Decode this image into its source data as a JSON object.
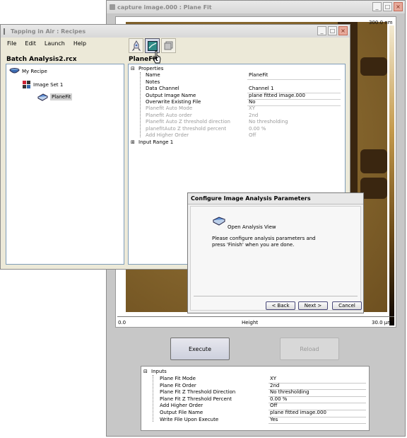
{
  "plane_window": {
    "title": "capture image.000 : Plane Fit",
    "colorbar_max": "300.0 nm",
    "x_axis_start": "0.0",
    "x_axis_label": "Height",
    "x_axis_end": "30.0 µm",
    "execute_label": "Execute",
    "reload_label": "Reload",
    "inputs_header": "Inputs",
    "inputs": [
      {
        "name": "Plane Fit Mode",
        "value": "XY"
      },
      {
        "name": "Plane Fit Order",
        "value": "2nd"
      },
      {
        "name": "Plane Fit Z Threshold Direction",
        "value": "No thresholding"
      },
      {
        "name": "Plane Fit Z Threshold Percent",
        "value": "0.00 %"
      },
      {
        "name": "Add Higher Order",
        "value": "Off"
      },
      {
        "name": "Output File Name",
        "value": "plane fitted image.000"
      },
      {
        "name": "Write File Upon Execute",
        "value": "Yes"
      }
    ]
  },
  "recipe_window": {
    "title": "Tapping in Air : Recipes",
    "menu": [
      "File",
      "Edit",
      "Launch",
      "Help"
    ],
    "file_title": "Batch Analysis2.rcx",
    "panel_title": "PlaneFit",
    "tree": {
      "root": "My Recipe",
      "image_set": "Image Set 1",
      "leaf": "PlaneFit"
    },
    "properties_header": "Properties",
    "properties": [
      {
        "name": "Name",
        "value": "PlaneFit",
        "enabled": true
      },
      {
        "name": "Notes",
        "value": "",
        "enabled": true
      },
      {
        "name": "Data Channel",
        "value": "Channel 1",
        "enabled": true
      },
      {
        "name": "Output Image Name",
        "value": "plane fitted image.000",
        "enabled": true
      },
      {
        "name": "Overwrite Existing File",
        "value": "No",
        "enabled": true
      },
      {
        "name": "Planefit Auto Mode",
        "value": "XY",
        "enabled": false
      },
      {
        "name": "Planefit Auto order",
        "value": "2nd",
        "enabled": false
      },
      {
        "name": "Planefit Auto Z threshold direction",
        "value": "No thresholding",
        "enabled": false
      },
      {
        "name": "planefitAuto Z threshold percent",
        "value": "0.00 %",
        "enabled": false
      },
      {
        "name": "Add Higher Order",
        "value": "Off",
        "enabled": false
      }
    ],
    "input_range": "Input Range 1"
  },
  "dialog": {
    "title": "Configure Image Analysis Parameters",
    "option_label": "Open Analysis View",
    "message_line1": "Please configure analysis parameters and",
    "message_line2": "press 'Finish' when you are done.",
    "back_label": "< Back",
    "next_label": "Next >",
    "cancel_label": "Cancel"
  }
}
